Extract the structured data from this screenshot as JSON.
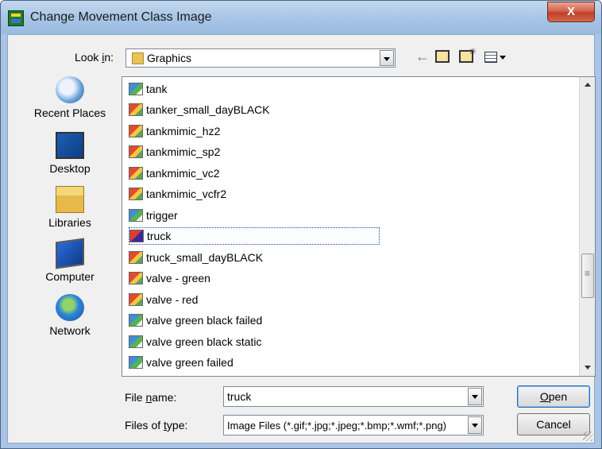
{
  "window": {
    "title": "Change Movement Class Image",
    "close_label": "X"
  },
  "toolbar": {
    "look_in_label": "Look in:",
    "look_in_value": "Graphics",
    "icons": [
      "back-arrow-icon",
      "up-folder-icon",
      "new-folder-icon",
      "view-menu-icon"
    ]
  },
  "places": [
    {
      "label": "Recent Places",
      "icon": "recent-places-icon"
    },
    {
      "label": "Desktop",
      "icon": "desktop-icon"
    },
    {
      "label": "Libraries",
      "icon": "libraries-icon"
    },
    {
      "label": "Computer",
      "icon": "computer-icon"
    },
    {
      "label": "Network",
      "icon": "network-icon"
    }
  ],
  "files": [
    {
      "name": "tank",
      "type": "image"
    },
    {
      "name": "tanker_small_dayBLACK",
      "type": "metafile"
    },
    {
      "name": "tankmimic_hz2",
      "type": "metafile"
    },
    {
      "name": "tankmimic_sp2",
      "type": "metafile"
    },
    {
      "name": "tankmimic_vc2",
      "type": "metafile"
    },
    {
      "name": "tankmimic_vcfr2",
      "type": "metafile"
    },
    {
      "name": "trigger",
      "type": "image"
    },
    {
      "name": "truck",
      "type": "selected"
    },
    {
      "name": "truck_small_dayBLACK",
      "type": "metafile"
    },
    {
      "name": "valve - green",
      "type": "metafile"
    },
    {
      "name": "valve - red",
      "type": "metafile"
    },
    {
      "name": "valve green black failed",
      "type": "image"
    },
    {
      "name": "valve green black static",
      "type": "image"
    },
    {
      "name": "valve green failed",
      "type": "image"
    }
  ],
  "selected_file": "truck",
  "scrollbar": {
    "position_fraction": 0.72
  },
  "filename": {
    "label": "File name:",
    "value": "truck"
  },
  "filetype": {
    "label": "Files of type:",
    "value": "Image Files (*.gif;*.jpg;*.jpeg;*.bmp;*.wmf;*.png)"
  },
  "buttons": {
    "open": "Open",
    "cancel": "Cancel"
  },
  "colors": {
    "frame": "#a9c4e4",
    "close": "#c0402a",
    "selection_border": "#1f4c9a"
  }
}
